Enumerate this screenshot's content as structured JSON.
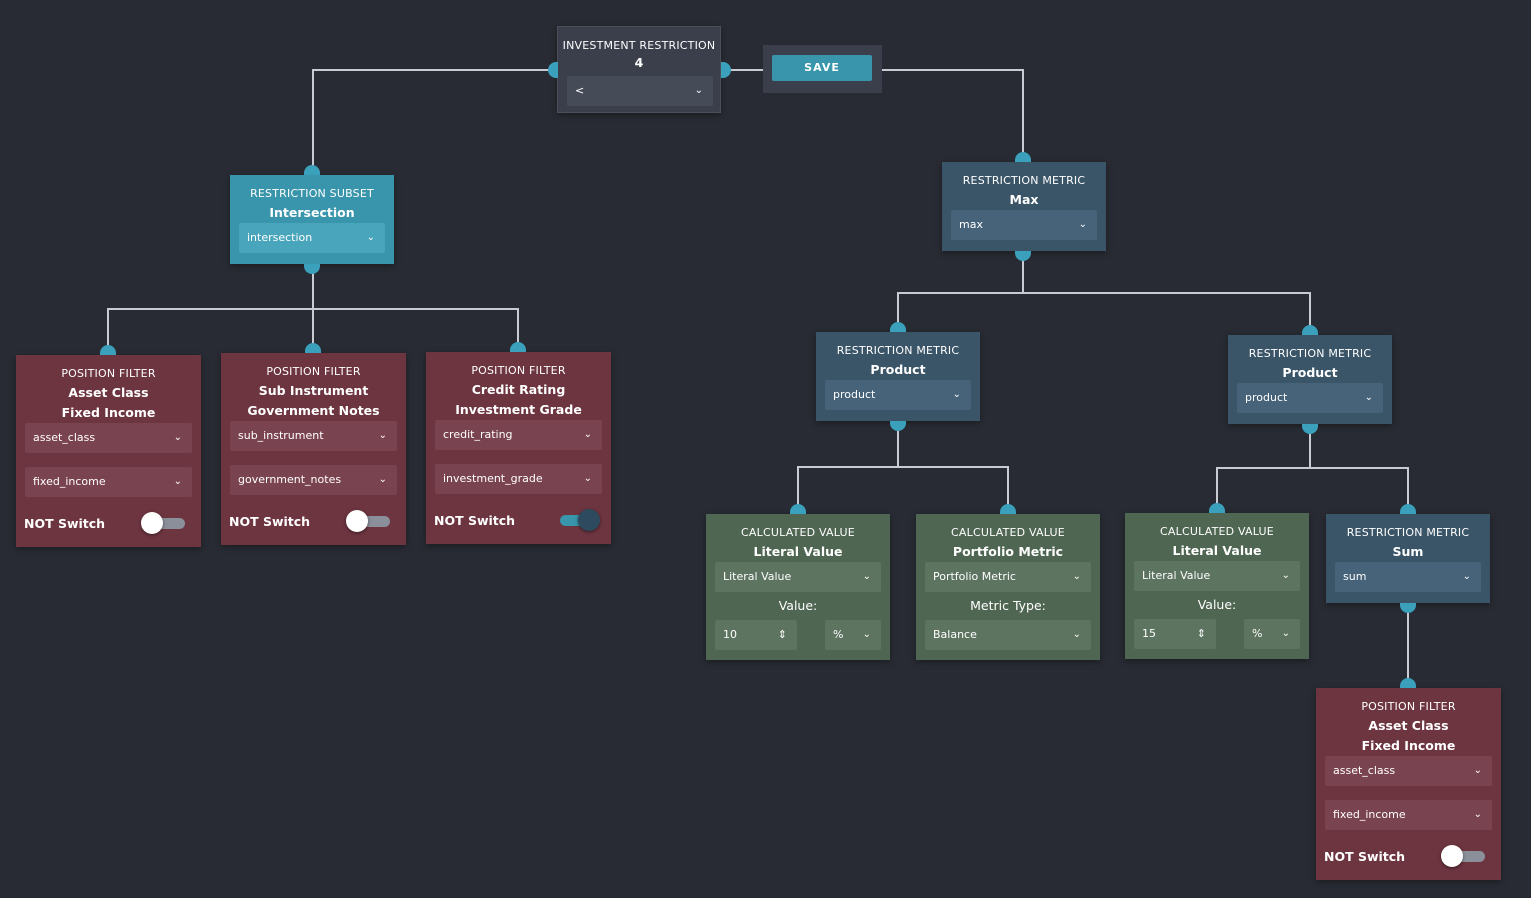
{
  "root": {
    "title": "INVESTMENT RESTRICTION",
    "value": "4",
    "operator": "<"
  },
  "save_label": "SAVE",
  "subset": {
    "title": "RESTRICTION SUBSET",
    "name": "Intersection",
    "select": "intersection"
  },
  "filters": [
    {
      "title": "POSITION FILTER",
      "name1": "Asset Class",
      "name2": "Fixed Income",
      "select1": "asset_class",
      "select2": "fixed_income",
      "switch_label": "NOT Switch",
      "switch_on": false
    },
    {
      "title": "POSITION FILTER",
      "name1": "Sub Instrument",
      "name2": "Government Notes",
      "select1": "sub_instrument",
      "select2": "government_notes",
      "switch_label": "NOT Switch",
      "switch_on": false
    },
    {
      "title": "POSITION FILTER",
      "name1": "Credit Rating",
      "name2": "Investment Grade",
      "select1": "credit_rating",
      "select2": "investment_grade",
      "switch_label": "NOT Switch",
      "switch_on": true
    },
    {
      "title": "POSITION FILTER",
      "name1": "Asset Class",
      "name2": "Fixed Income",
      "select1": "asset_class",
      "select2": "fixed_income",
      "switch_label": "NOT Switch",
      "switch_on": false
    }
  ],
  "metrics": {
    "max": {
      "title": "RESTRICTION METRIC",
      "name": "Max",
      "select": "max"
    },
    "product1": {
      "title": "RESTRICTION METRIC",
      "name": "Product",
      "select": "product"
    },
    "product2": {
      "title": "RESTRICTION METRIC",
      "name": "Product",
      "select": "product"
    },
    "sum": {
      "title": "RESTRICTION METRIC",
      "name": "Sum",
      "select": "sum"
    }
  },
  "calculated": [
    {
      "title": "CALCULATED VALUE",
      "name": "Literal Value",
      "select": "Literal Value",
      "field_label": "Value:",
      "value": "10",
      "unit": "%"
    },
    {
      "title": "CALCULATED VALUE",
      "name": "Portfolio Metric",
      "select": "Portfolio Metric",
      "field_label": "Metric Type:",
      "metric_type": "Balance"
    },
    {
      "title": "CALCULATED VALUE",
      "name": "Literal Value",
      "select": "Literal Value",
      "field_label": "Value:",
      "value": "15",
      "unit": "%"
    }
  ],
  "icons": {
    "chevron": "chevron-down-icon",
    "stepper": "stepper-icon"
  },
  "colors": {
    "background": "#282b33",
    "teal": "#3895ab",
    "slate": "#3a5568",
    "filter": "#6d3540",
    "calc": "#4f6652",
    "wire": "#c8ccd2"
  }
}
